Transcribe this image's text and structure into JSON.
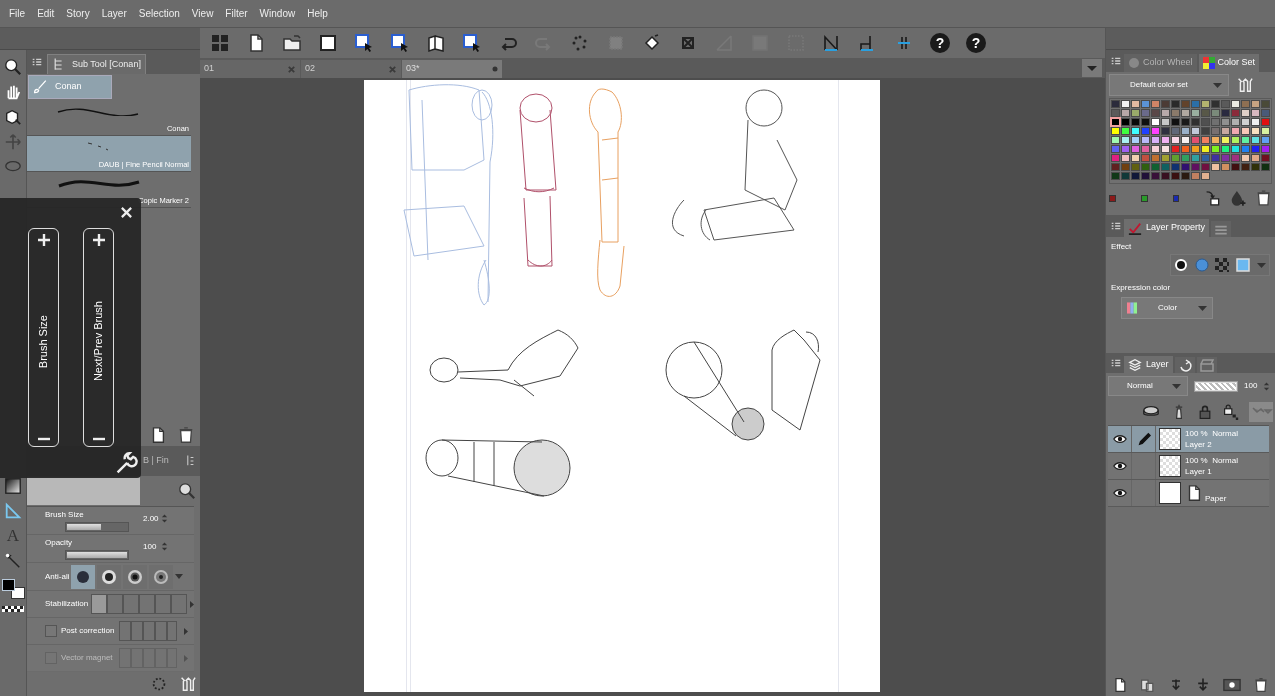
{
  "menu": [
    "File",
    "Edit",
    "Story",
    "Layer",
    "Selection",
    "View",
    "Filter",
    "Window",
    "Help"
  ],
  "sub_tool": {
    "title": "Sub Tool [Conan]",
    "group": {
      "label": "Conan",
      "selected": true
    },
    "brushes": [
      {
        "name": "Conan",
        "selected": false
      },
      {
        "name": "DAUB | Fine Pencil Normal",
        "selected": true
      },
      {
        "name": "Copic Marker 2",
        "selected": false
      }
    ]
  },
  "tools": {
    "text_tool_label": "A"
  },
  "quick_panel": {
    "sliders": [
      {
        "label": "Brush Size"
      },
      {
        "label": "Next/Prev Brush"
      }
    ]
  },
  "tool_property": {
    "tab_label": "B | Fin",
    "brush_size": {
      "label": "Brush Size",
      "value": "2.00",
      "level": 0.56
    },
    "opacity": {
      "label": "Opacity",
      "value": "100",
      "level": 1
    },
    "anti_alias": {
      "label": "Anti-ali",
      "options": [
        {
          "selected": true
        },
        {
          "selected": false
        },
        {
          "selected": false
        },
        {
          "selected": false
        }
      ]
    },
    "stabilization": {
      "label": "Stabilization",
      "segments": [
        {
          "selected": true
        },
        {
          "selected": false
        },
        {
          "selected": false
        },
        {
          "selected": false
        },
        {
          "selected": false
        },
        {
          "selected": false
        }
      ]
    },
    "post_correction": {
      "label": "Post correction",
      "checked": false,
      "disabled": false
    },
    "vector_magnet": {
      "label": "Vector magnet",
      "checked": false,
      "disabled": true
    }
  },
  "toolbar": [
    {
      "disabled": false
    },
    {
      "disabled": false
    },
    {
      "disabled": false
    },
    {
      "disabled": false
    },
    {
      "disabled": false
    },
    {
      "disabled": false
    },
    {
      "disabled": false
    },
    {
      "disabled": false
    },
    {
      "disabled": false
    },
    {
      "disabled": true
    },
    {
      "disabled": false
    },
    {
      "disabled": true
    },
    {
      "disabled": false
    },
    {
      "disabled": false
    },
    {
      "disabled": true
    },
    {
      "disabled": true
    },
    {
      "disabled": true
    },
    {
      "disabled": false
    },
    {
      "disabled": false
    },
    {
      "disabled": false
    }
  ],
  "help_buttons": [
    "?",
    "?"
  ],
  "canvas_tabs": [
    {
      "label": "01",
      "selected": false,
      "modified": false
    },
    {
      "label": "02",
      "selected": false,
      "modified": false
    },
    {
      "label": "03*",
      "selected": true,
      "modified": true
    }
  ],
  "color_panel": {
    "tabs": [
      {
        "label": "Color Wheel",
        "selected": false
      },
      {
        "label": "Color Set",
        "selected": true
      }
    ],
    "color_set": "Default color set",
    "swatches": [
      {
        "color": "#2b2b3b",
        "selected": false
      },
      {
        "color": "#f2f2f2",
        "selected": false
      },
      {
        "color": "#e2b9a1",
        "selected": false
      },
      {
        "color": "#5b93d6",
        "selected": false
      },
      {
        "color": "#cf8466",
        "selected": false
      },
      {
        "color": "#4b3b35",
        "selected": false
      },
      {
        "color": "#2a2a2a",
        "selected": false
      },
      {
        "color": "#62432c",
        "selected": false
      },
      {
        "color": "#2b6ea6",
        "selected": false
      },
      {
        "color": "#b3b36f",
        "selected": false
      },
      {
        "color": "#303030",
        "selected": false
      },
      {
        "color": "#5a5a5a",
        "selected": false
      },
      {
        "color": "#ebebe3",
        "selected": false
      },
      {
        "color": "#8e6f52",
        "selected": false
      },
      {
        "color": "#c6a382",
        "selected": false
      },
      {
        "color": "#4a4a38",
        "selected": false
      },
      {
        "color": "#5a5a5a",
        "selected": false
      },
      {
        "color": "#b8a8a8",
        "selected": false
      },
      {
        "color": "#9aaa6a",
        "selected": false
      },
      {
        "color": "#6a6a8a",
        "selected": false
      },
      {
        "color": "#5a4848",
        "selected": false
      },
      {
        "color": "#b8aaaa",
        "selected": false
      },
      {
        "color": "#8a7a6a",
        "selected": false
      },
      {
        "color": "#b0a8a0",
        "selected": false
      },
      {
        "color": "#9ab0a0",
        "selected": false
      },
      {
        "color": "#585848",
        "selected": false
      },
      {
        "color": "#7a8a7a",
        "selected": false
      },
      {
        "color": "#2a2a40",
        "selected": false
      },
      {
        "color": "#8a2a3a",
        "selected": false
      },
      {
        "color": "#e0d0c8",
        "selected": false
      },
      {
        "color": "#d8b8c0",
        "selected": false
      },
      {
        "color": "#4a5a78",
        "selected": false
      },
      {
        "color": "#000000",
        "selected": true
      },
      {
        "color": "#000000",
        "selected": false
      },
      {
        "color": "#0a0a0a",
        "selected": false
      },
      {
        "color": "#101010",
        "selected": false
      },
      {
        "color": "#ffffff",
        "selected": false
      },
      {
        "color": "#c8c8c8",
        "selected": false
      },
      {
        "color": "#101010",
        "selected": false
      },
      {
        "color": "#1a1a1a",
        "selected": false
      },
      {
        "color": "#303030",
        "selected": false
      },
      {
        "color": "#505050",
        "selected": false
      },
      {
        "color": "#707070",
        "selected": false
      },
      {
        "color": "#909090",
        "selected": false
      },
      {
        "color": "#b0b0b0",
        "selected": false
      },
      {
        "color": "#d0d0d0",
        "selected": false
      },
      {
        "color": "#f0f0f0",
        "selected": false
      },
      {
        "color": "#e01010",
        "selected": false
      },
      {
        "color": "#ffff00",
        "selected": false
      },
      {
        "color": "#40ff40",
        "selected": false
      },
      {
        "color": "#40ffff",
        "selected": false
      },
      {
        "color": "#2040ff",
        "selected": false
      },
      {
        "color": "#ff40ff",
        "selected": false
      },
      {
        "color": "#303040",
        "selected": false
      },
      {
        "color": "#606878",
        "selected": false
      },
      {
        "color": "#9ab0c8",
        "selected": false
      },
      {
        "color": "#c0c8d8",
        "selected": false
      },
      {
        "color": "#404040",
        "selected": false
      },
      {
        "color": "#787070",
        "selected": false
      },
      {
        "color": "#c8a8a0",
        "selected": false
      },
      {
        "color": "#f0a8b0",
        "selected": false
      },
      {
        "color": "#f8c8b8",
        "selected": false
      },
      {
        "color": "#f8e0c0",
        "selected": false
      },
      {
        "color": "#d8f0a0",
        "selected": false
      },
      {
        "color": "#a0f8b0",
        "selected": false
      },
      {
        "color": "#a8f0f0",
        "selected": false
      },
      {
        "color": "#a8d0f8",
        "selected": false
      },
      {
        "color": "#b8b8f8",
        "selected": false
      },
      {
        "color": "#d8b0f8",
        "selected": false
      },
      {
        "color": "#f0b0f0",
        "selected": false
      },
      {
        "color": "#f8d8e8",
        "selected": false
      },
      {
        "color": "#f8f0f0",
        "selected": false
      },
      {
        "color": "#e05070",
        "selected": false
      },
      {
        "color": "#f08060",
        "selected": false
      },
      {
        "color": "#f0b060",
        "selected": false
      },
      {
        "color": "#f0f060",
        "selected": false
      },
      {
        "color": "#b0f060",
        "selected": false
      },
      {
        "color": "#60f0a0",
        "selected": false
      },
      {
        "color": "#60e0e0",
        "selected": false
      },
      {
        "color": "#60a0f0",
        "selected": false
      },
      {
        "color": "#6060f0",
        "selected": false
      },
      {
        "color": "#a060f0",
        "selected": false
      },
      {
        "color": "#e060e0",
        "selected": false
      },
      {
        "color": "#e060a0",
        "selected": false
      },
      {
        "color": "#f8d0d8",
        "selected": false
      },
      {
        "color": "#f8e0e0",
        "selected": false
      },
      {
        "color": "#e02020",
        "selected": false
      },
      {
        "color": "#f06020",
        "selected": false
      },
      {
        "color": "#f0a020",
        "selected": false
      },
      {
        "color": "#f0f020",
        "selected": false
      },
      {
        "color": "#80f020",
        "selected": false
      },
      {
        "color": "#20f080",
        "selected": false
      },
      {
        "color": "#20e0e0",
        "selected": false
      },
      {
        "color": "#2080f0",
        "selected": false
      },
      {
        "color": "#2020f0",
        "selected": false
      },
      {
        "color": "#a020f0",
        "selected": false
      },
      {
        "color": "#e02080",
        "selected": false
      },
      {
        "color": "#f0c0c0",
        "selected": false
      },
      {
        "color": "#f0d0b0",
        "selected": false
      },
      {
        "color": "#c05040",
        "selected": false
      },
      {
        "color": "#c07030",
        "selected": false
      },
      {
        "color": "#a0a030",
        "selected": false
      },
      {
        "color": "#60a030",
        "selected": false
      },
      {
        "color": "#30a060",
        "selected": false
      },
      {
        "color": "#30a0a0",
        "selected": false
      },
      {
        "color": "#3060a0",
        "selected": false
      },
      {
        "color": "#4030a0",
        "selected": false
      },
      {
        "color": "#8030a0",
        "selected": false
      },
      {
        "color": "#a03080",
        "selected": false
      },
      {
        "color": "#f0c8b0",
        "selected": false
      },
      {
        "color": "#e0a888",
        "selected": false
      },
      {
        "color": "#701020",
        "selected": false
      },
      {
        "color": "#602020",
        "selected": false
      },
      {
        "color": "#704010",
        "selected": false
      },
      {
        "color": "#606010",
        "selected": false
      },
      {
        "color": "#306010",
        "selected": false
      },
      {
        "color": "#106030",
        "selected": false
      },
      {
        "color": "#106060",
        "selected": false
      },
      {
        "color": "#103070",
        "selected": false
      },
      {
        "color": "#301070",
        "selected": false
      },
      {
        "color": "#601060",
        "selected": false
      },
      {
        "color": "#701040",
        "selected": false
      },
      {
        "color": "#f0c0a0",
        "selected": false
      },
      {
        "color": "#d09060",
        "selected": false
      },
      {
        "color": "#401010",
        "selected": false
      },
      {
        "color": "#402010",
        "selected": false
      },
      {
        "color": "#303008",
        "selected": false
      },
      {
        "color": "#103010",
        "selected": false
      },
      {
        "color": "#103818",
        "selected": false
      },
      {
        "color": "#103838",
        "selected": false
      },
      {
        "color": "#101838",
        "selected": false
      },
      {
        "color": "#201038",
        "selected": false
      },
      {
        "color": "#381038",
        "selected": false
      },
      {
        "color": "#381020",
        "selected": false
      },
      {
        "color": "#3a1010",
        "selected": false
      },
      {
        "color": "#2a1a10",
        "selected": false
      },
      {
        "color": "#c08060",
        "selected": false
      },
      {
        "color": "#e0b090",
        "selected": false
      }
    ],
    "recent_colors": [
      {
        "color": "#8b1a1a"
      },
      {
        "color": "#2a9a2a"
      },
      {
        "color": "#1a2ab0"
      }
    ]
  },
  "layer_property": {
    "tab_label": "Layer Property",
    "effect_label": "Effect",
    "expression_label": "Expression color",
    "expression_value": "Color"
  },
  "layer_panel": {
    "tab_label": "Layer",
    "blend_mode": "Normal",
    "opacity": {
      "value": "100",
      "level": 1
    },
    "layers": [
      {
        "kind": "raster",
        "info": "100 %  Normal",
        "name": "Layer 2",
        "visible": true,
        "editing": true,
        "selected": true
      },
      {
        "kind": "raster",
        "info": "100 %  Normal",
        "name": "Layer 1",
        "visible": true,
        "editing": false,
        "selected": false
      },
      {
        "kind": "paper",
        "name": "Paper",
        "visible": true,
        "editing": false,
        "selected": false
      }
    ]
  }
}
